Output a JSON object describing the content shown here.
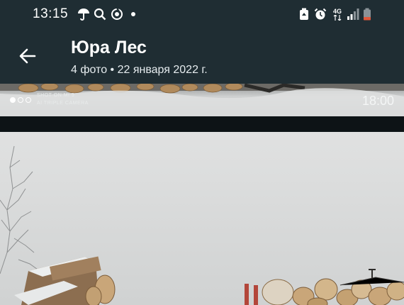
{
  "status_bar": {
    "time": "13:15",
    "left_icons": [
      "umbrella-icon",
      "search-icon",
      "sync-icon",
      "dot-icon"
    ],
    "right_icons": [
      "battery-saver-icon",
      "alarm-icon",
      "network-4g-icon",
      "signal-icon",
      "battery-low-icon"
    ],
    "network_label": "4G"
  },
  "header": {
    "back_icon": "arrow-back-icon",
    "title": "Юра Лес",
    "subtitle": "4 фото  •  22 января 2022 г."
  },
  "preview_strip": {
    "watermark_line1": "SHOT ON MI 9",
    "watermark_line2": "AI TRIPLE CAMERA",
    "time": "18:00"
  },
  "colors": {
    "bar_bg": "#1f2d33",
    "divider": "#0d1316",
    "battery_low": "#e0573a"
  }
}
